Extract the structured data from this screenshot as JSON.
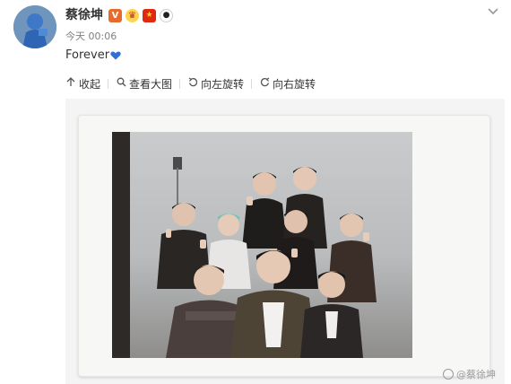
{
  "user": {
    "name": "蔡徐坤"
  },
  "badges": {
    "v": "V",
    "crown": "♛",
    "flag": "★",
    "panda": "●"
  },
  "post": {
    "time": "今天 00:06",
    "text": "Forever"
  },
  "toolbar": {
    "collapse": "收起",
    "view_large": "查看大图",
    "rotate_left": "向左旋转",
    "rotate_right": "向右旋转"
  },
  "icons": {
    "collapse": "arrow-up-icon",
    "view_large": "magnifier-icon",
    "rotate_left": "rotate-left-icon",
    "rotate_right": "rotate-right-icon"
  },
  "watermark": {
    "text": "@蔡徐坤"
  },
  "colors": {
    "accent_verified": "#e86b2e",
    "heart": "#2f6fd6"
  }
}
